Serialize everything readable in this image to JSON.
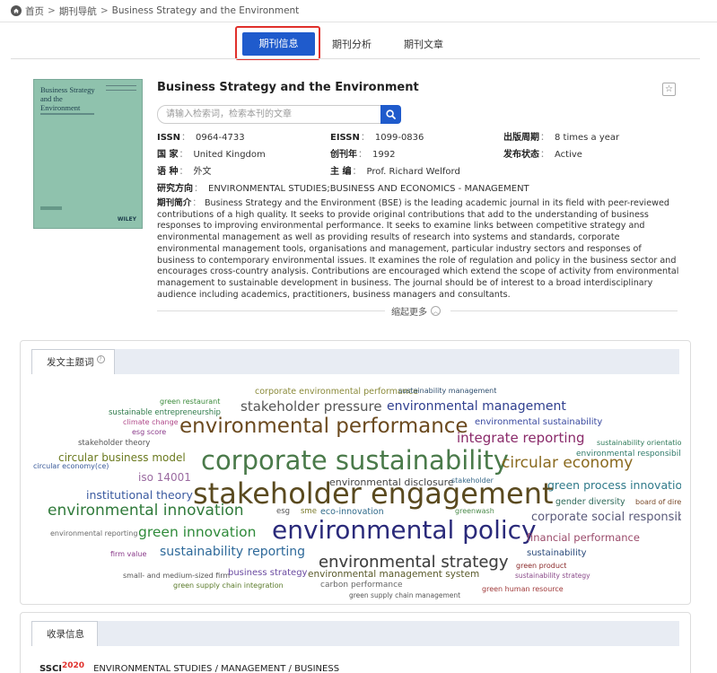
{
  "breadcrumb": {
    "home": "首页",
    "nav": "期刊导航",
    "current": "Business Strategy and the Environment",
    "sep": ">"
  },
  "tabs": [
    {
      "label": "期刊信息",
      "active": true
    },
    {
      "label": "期刊分析",
      "active": false
    },
    {
      "label": "期刊文章",
      "active": false
    }
  ],
  "cover": {
    "title": "Business Strategy and the Environment",
    "publisher": "WILEY"
  },
  "journal": {
    "title": "Business Strategy and the Environment",
    "search_placeholder": "请输入检索词，检索本刊的文章",
    "issn_label": "ISSN",
    "issn": "0964-4733",
    "eissn_label": "EISSN",
    "eissn": "1099-0836",
    "period_label": "出版周期",
    "period": "8 times a year",
    "country_label": "国 家",
    "country": "United Kingdom",
    "founded_label": "创刊年",
    "founded": "1992",
    "status_label": "发布状态",
    "status": "Active",
    "language_label": "语 种",
    "language": "外文",
    "editor_label": "主 编",
    "editor": "Prof. Richard Welford",
    "field_label": "研究方向",
    "field": "ENVIRONMENTAL STUDIES;BUSINESS AND ECONOMICS - MANAGEMENT",
    "desc_label": "期刊简介",
    "desc": "Business Strategy and the Environment (BSE) is the leading academic journal in its field with peer-reviewed contributions of a high quality. It seeks to provide original contributions that add to the understanding of business responses to improving environmental performance. It seeks to examine links between competitive strategy and environmental management as well as providing results of research into systems and standards, corporate environmental management tools, organisations and management, particular industry sectors and responses of business to contemporary environmental issues. It examines the role of regulation and policy in the business sector and encourages cross-country analysis. Contributions are encouraged which extend the scope of activity from environmental management to sustainable development in business. The journal should be of interest to a broad interdisciplinary audience including academics, practitioners, business managers and consultants.",
    "collapse_label": "缩起更多",
    "colon": "："
  },
  "wordcloud": {
    "tab_label": "发文主题词",
    "help_icon": "?",
    "words": [
      {
        "t": "corporate environmental performance",
        "c": "#8a8a3a"
      },
      {
        "t": "sustainability management",
        "c": "#2f4f6f"
      },
      {
        "t": "green restaurant",
        "c": "#3a8a3a"
      },
      {
        "t": "sustainable entrepreneurship",
        "c": "#2e7a4a"
      },
      {
        "t": "stakeholder pressure",
        "c": "#555555"
      },
      {
        "t": "environmental management",
        "c": "#2f3f8f"
      },
      {
        "t": "climate change",
        "c": "#b04a8a"
      },
      {
        "t": "environmental sustainability",
        "c": "#3a4aa0"
      },
      {
        "t": "esg score",
        "c": "#8a3a8a"
      },
      {
        "t": "environmental performance",
        "c": "#6b4a1f"
      },
      {
        "t": "stakeholder theory",
        "c": "#555555"
      },
      {
        "t": "integrate reporting",
        "c": "#8a2a6a"
      },
      {
        "t": "sustainability orientation",
        "c": "#2f7a5a"
      },
      {
        "t": "circular business model",
        "c": "#6b7a1f"
      },
      {
        "t": "corporate sustainability",
        "c": "#4a7a4a"
      },
      {
        "t": "environmental responsibility",
        "c": "#2f7a6a"
      },
      {
        "t": "circular economy",
        "c": "#8a6a1f"
      },
      {
        "t": "environmental strategy",
        "c": "#555555"
      },
      {
        "t": "iso 14001",
        "c": "#9a6aa0"
      },
      {
        "t": "circular economy(ce)",
        "c": "#3a5a9a"
      },
      {
        "t": "environmental disclosure",
        "c": "#444444"
      },
      {
        "t": "stakeholder",
        "c": "#3a6a8a"
      },
      {
        "t": "green process innovation",
        "c": "#2f7a8a"
      },
      {
        "t": "institutional theory",
        "c": "#3a5aa0"
      },
      {
        "t": "stakeholder engagement",
        "c": "#5a4a1f"
      },
      {
        "t": "gender diversity",
        "c": "#2f6a5a"
      },
      {
        "t": "board of directo",
        "c": "#7a4a2a"
      },
      {
        "t": "environmental innovation",
        "c": "#2f7a3a"
      },
      {
        "t": "esg",
        "c": "#555555"
      },
      {
        "t": "sme",
        "c": "#7a7a2a"
      },
      {
        "t": "eco-innovation",
        "c": "#2f6a8a"
      },
      {
        "t": "greenwash",
        "c": "#4a8a4a"
      },
      {
        "t": "corporate social responsibility",
        "c": "#5a5a7a"
      },
      {
        "t": "environmental reporting",
        "c": "#6a6a6a"
      },
      {
        "t": "green innovation",
        "c": "#2f8a3a"
      },
      {
        "t": "environmental policy",
        "c": "#2a2a7a"
      },
      {
        "t": "financial performance",
        "c": "#9a4a6a"
      },
      {
        "t": "firm value",
        "c": "#8a3a8a"
      },
      {
        "t": "sustainability reporting",
        "c": "#2f6a9a"
      },
      {
        "t": "sustainability",
        "c": "#2a4a7a"
      },
      {
        "t": "green product",
        "c": "#8a2a2a"
      },
      {
        "t": "small- and medium-sized firm",
        "c": "#555555"
      },
      {
        "t": "business strategy",
        "c": "#6a4aa0"
      },
      {
        "t": "environmental management system",
        "c": "#5a5a2a"
      },
      {
        "t": "sustainability strategy",
        "c": "#8a4a8a"
      },
      {
        "t": "green supply chain integration",
        "c": "#5a7a2a"
      },
      {
        "t": "carbon performance",
        "c": "#666666"
      },
      {
        "t": "green human resource",
        "c": "#a03a3a"
      },
      {
        "t": "environmental strategy",
        "c": "#444444"
      },
      {
        "t": "green supply chain management",
        "c": "#555555"
      }
    ]
  },
  "indexing": {
    "tab_label": "收录信息",
    "row_db": "SSCI",
    "row_year": "2020",
    "row_cats": "ENVIRONMENTAL STUDIES / MANAGEMENT / BUSINESS"
  }
}
